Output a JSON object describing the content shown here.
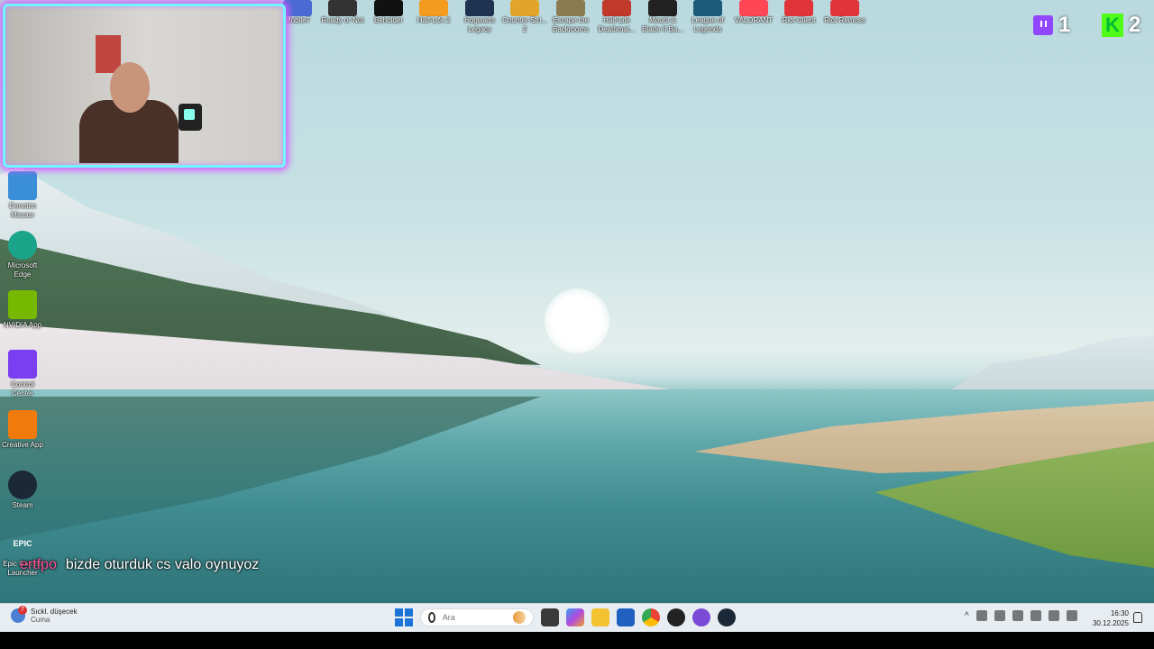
{
  "top_icons": [
    {
      "label": "Mobile7",
      "color": "#4a6bd4"
    },
    {
      "label": "Ready or Not",
      "color": "#333"
    },
    {
      "label": "Beholder",
      "color": "#111"
    },
    {
      "label": "Half-Life 2",
      "color": "#f39a1f"
    },
    {
      "label": "Hogwarts Legacy",
      "color": "#1e3350"
    },
    {
      "label": "Counter-Stri... 2",
      "color": "#e2a52a"
    },
    {
      "label": "Escape the Backrooms",
      "color": "#8a7c50"
    },
    {
      "label": "Half-Life Deathmat...",
      "color": "#c0392b"
    },
    {
      "label": "Mount & Blade II Ba...",
      "color": "#222"
    },
    {
      "label": "League of Legends",
      "color": "#1b5a7a"
    },
    {
      "label": "VALORANT",
      "color": "#ff4655"
    },
    {
      "label": "Riot Client",
      "color": "#e0343a"
    },
    {
      "label": "Riot Remoss",
      "color": "#e0343a"
    }
  ],
  "left_icons": [
    {
      "label": "Denetim Masası",
      "color": "#3b8fd8",
      "glyph": ""
    },
    {
      "label": "Microsoft Edge",
      "color": "#1aa58a",
      "glyph": ""
    },
    {
      "label": "NVIDIA App",
      "color": "#76b900",
      "glyph": ""
    },
    {
      "label": "Control Center",
      "color": "#7a3ff0",
      "glyph": ""
    },
    {
      "label": "Creative App",
      "color": "#f07a0c",
      "glyph": ""
    },
    {
      "label": "Steam",
      "color": "#1b2838",
      "glyph": ""
    },
    {
      "label": "Epic Games Launcher",
      "color": "#111",
      "glyph": "EPIC"
    }
  ],
  "counters": {
    "twitch": "1",
    "kick": "2",
    "kick_glyph": "K"
  },
  "chat": {
    "user": "ertfpo",
    "message": "bizde oturduk cs valo oynuyoz"
  },
  "taskbar": {
    "weather_line1": "Sıckl. düşecek",
    "weather_line2": "Cuma",
    "weather_badge": "7",
    "search_placeholder": "Ara",
    "time": "16:30",
    "date": "30.12.2025",
    "tray_chevron": "^"
  }
}
